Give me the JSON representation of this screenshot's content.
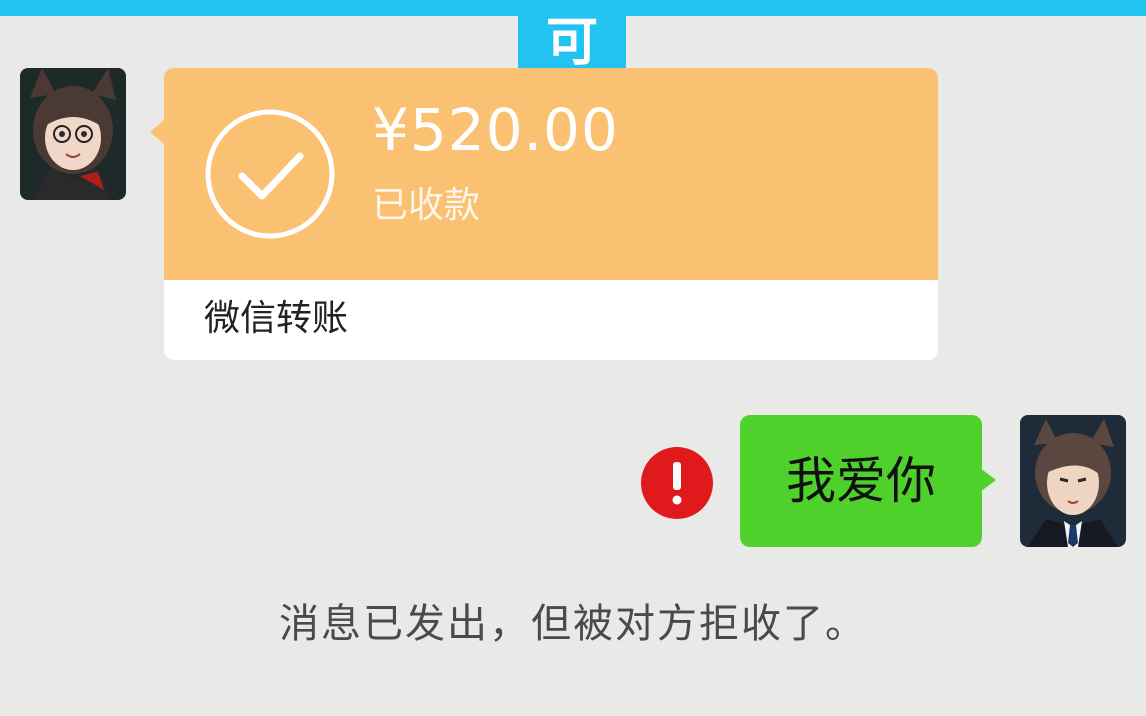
{
  "banner": {
    "text": "可"
  },
  "transfer": {
    "amount": "¥520.00",
    "status": "已收款",
    "label": "微信转账",
    "icon": "check-circle-icon",
    "color": "#fbc173"
  },
  "message": {
    "text": "我爱你",
    "bubble_color": "#4fd12c",
    "error_icon": "exclamation-circle-icon",
    "error_color": "#e0191c"
  },
  "system_notice": "消息已发出，但被对方拒收了。",
  "avatars": {
    "left": "girl-avatar",
    "right": "boy-avatar"
  }
}
